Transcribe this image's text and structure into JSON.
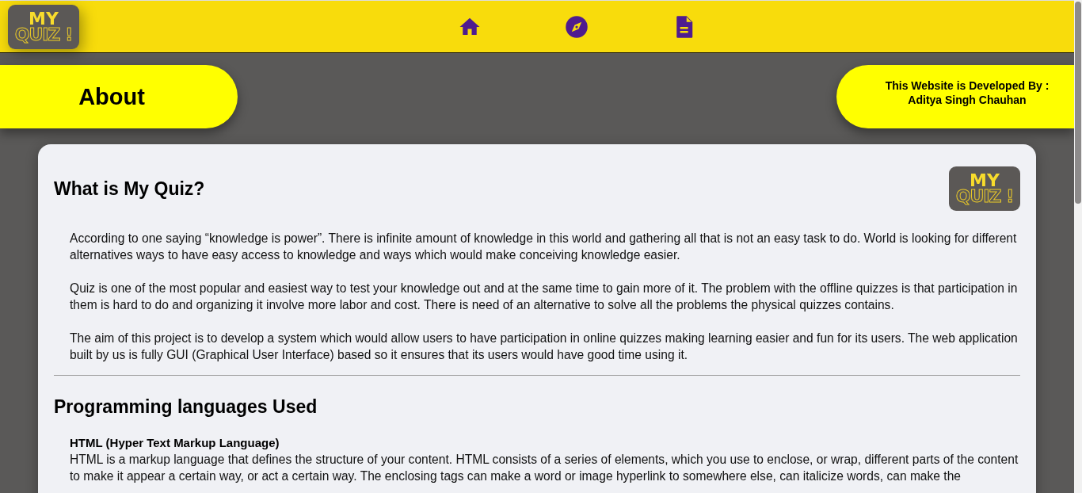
{
  "header": {
    "logo": {
      "line_1": "MY",
      "line_2": "QUIZ !"
    }
  },
  "page_title": "About",
  "developer": {
    "line_1": "This Website is Developed By :",
    "line_2": "Aditya Singh Chauhan"
  },
  "sections": [
    {
      "heading": "What is My Quiz?",
      "logo": {
        "line_1": "MY",
        "line_2": "QUIZ !"
      },
      "items": [
        {
          "kind": "paragraph",
          "text": "According to one saying “knowledge is power”. There is infinite amount of knowledge in this world and gathering all that is not an easy task to do. World is looking for different alternatives ways to have easy access to knowledge and ways which would make conceiving knowledge easier."
        },
        {
          "kind": "paragraph",
          "text": "Quiz is one of the most popular and easiest way to test your knowledge out and at the same time to gain more of it. The problem with the offline quizzes is that participation in them is hard to do and organizing it involve more labor and cost. There is need of an alternative to solve all the problems the physical quizzes contains."
        },
        {
          "kind": "paragraph",
          "text": "The aim of this project is to develop a system which would allow users to have participation in online quizzes making learning easier and fun for its users. The web application built by us is fully GUI (Graphical User Interface) based so it ensures that its users would have good time using it."
        }
      ]
    },
    {
      "heading": "Programming languages Used",
      "items": [
        {
          "kind": "entry",
          "title": "HTML (Hyper Text Markup Language)",
          "text": "HTML is a markup language that defines the structure of your content. HTML consists of a series of elements, which you use to enclose, or wrap, different parts of the content to make it appear a certain way, or act a certain way. The enclosing tags can make a word or image hyperlink to somewhere else, can italicize words, can make the"
        }
      ]
    }
  ]
}
